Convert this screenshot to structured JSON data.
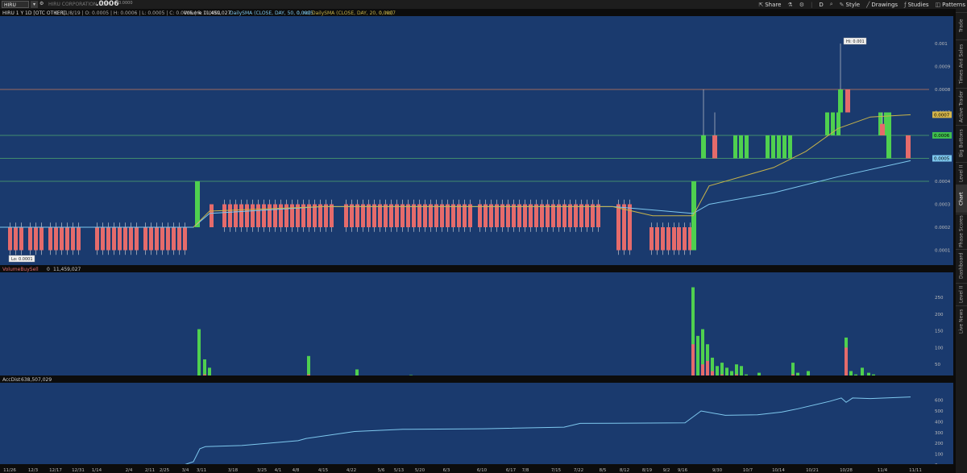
{
  "header": {
    "symbol": "HIRU",
    "company": "HIRU CORPORATION COM",
    "last": ".0006",
    "change_small": "0.0000",
    "toolbar": [
      "Share",
      "Style",
      "Drawings",
      "Studies",
      "Patterns"
    ],
    "toolbar_d": "D"
  },
  "price_panel": {
    "title": "HIRU 1 Y 1D [OTC OTHER]",
    "stats": "D: 11/8/19 | O: 0.0005 | H: 0.0006 | L: 0.0005 | C: 0.0006 | R: 0.0001",
    "volume_label": "Volume",
    "volume_value": "11,459,027",
    "sma50": "DailySMA (CLOSE, DAY, 50, 0, no)",
    "sma50_value": "0.0005",
    "sma20": "DailySMA (CLOSE, DAY, 20, 0, no)",
    "sma20_value": "0.0007",
    "hi_label": "Hi: 0.001",
    "lo_label": "Lo: 0.0001",
    "yticks": [
      "0.001",
      "0.0009",
      "0.0008",
      "0.0007",
      "0.0006",
      "0.0005",
      "0.0004",
      "0.0003",
      "0.0002",
      "0.0001"
    ],
    "tags": {
      "sma20": "0.0007",
      "close": "0.0006",
      "sma50": "0.0005"
    },
    "colors": {
      "background": "#1a3a6e",
      "up": "#4fd04f",
      "down": "#e56b6b",
      "sma20": "#c8b44a",
      "sma50": "#7ec8ee",
      "hline": "#4fa86e",
      "hline_top": "#c87a5a"
    }
  },
  "volume_panel": {
    "title": "VolumeBuySell",
    "value1": "0",
    "value2": "11,459,027",
    "yticks": [
      "250",
      "200",
      "150",
      "100",
      "50",
      "0"
    ]
  },
  "accdist_panel": {
    "title": "AccDist",
    "value": "638,507,029",
    "yticks": [
      "600",
      "500",
      "400",
      "300",
      "200",
      "100",
      "0"
    ]
  },
  "x_labels": [
    "11/26",
    "12/3",
    "12/17",
    "12/31",
    "1/14",
    "2/4",
    "2/11",
    "2/25",
    "3/4",
    "3/11",
    "3/18",
    "3/25",
    "4/1",
    "4/8",
    "4/15",
    "4/22",
    "5/6",
    "5/13",
    "5/20",
    "6/3",
    "6/10",
    "6/17",
    "7/8",
    "7/15",
    "7/22",
    "8/5",
    "8/12",
    "8/19",
    "9/2",
    "9/16",
    "9/30",
    "10/7",
    "10/14",
    "10/21",
    "10/28",
    "11/4",
    "11/11"
  ],
  "right_tabs": [
    "Trade",
    "Times And Sales",
    "Active Trader",
    "Big Buttons",
    "Level II",
    "Chart",
    "Phase Scores",
    "Dashboard",
    "Level II",
    "Live News"
  ],
  "chart_data": {
    "type": "candlestick",
    "price_unit": "USD",
    "ylim": [
      0,
      0.0011
    ],
    "candles": [
      {
        "x": "11/26",
        "o": 0.0002,
        "h": 0.0002,
        "l": 0.0001,
        "c": 0.0001
      },
      {
        "x": "12/3",
        "o": 0.0002,
        "h": 0.0002,
        "l": 0.0001,
        "c": 0.0001
      },
      {
        "x": "12/17",
        "o": 0.0002,
        "h": 0.0002,
        "l": 0.0001,
        "c": 0.0001
      },
      {
        "x": "12/31",
        "o": 0.0002,
        "h": 0.0002,
        "l": 0.0001,
        "c": 0.0001
      },
      {
        "x": "1/14",
        "o": 0.0002,
        "h": 0.0002,
        "l": 0.0001,
        "c": 0.0001
      },
      {
        "x": "2/4",
        "o": 0.0002,
        "h": 0.0002,
        "l": 0.0001,
        "c": 0.0001
      },
      {
        "x": "2/11",
        "o": 0.0002,
        "h": 0.0002,
        "l": 0.0001,
        "c": 0.0001
      },
      {
        "x": "2/25",
        "o": 0.0002,
        "h": 0.0002,
        "l": 0.0001,
        "c": 0.0001
      },
      {
        "x": "3/4",
        "o": 0.0002,
        "h": 0.0004,
        "l": 0.0002,
        "c": 0.0004
      },
      {
        "x": "3/11",
        "o": 0.0003,
        "h": 0.0003,
        "l": 0.0002,
        "c": 0.0002
      },
      {
        "x": "3/18",
        "o": 0.0003,
        "h": 0.0003,
        "l": 0.0002,
        "c": 0.0002
      },
      {
        "x": "4/8",
        "o": 0.0003,
        "h": 0.00035,
        "l": 0.0002,
        "c": 0.0002
      },
      {
        "x": "4/22",
        "o": 0.0003,
        "h": 0.0003,
        "l": 0.0002,
        "c": 0.0002
      },
      {
        "x": "5/20",
        "o": 0.0003,
        "h": 0.0003,
        "l": 0.0002,
        "c": 0.0002
      },
      {
        "x": "6/17",
        "o": 0.0003,
        "h": 0.0003,
        "l": 0.0002,
        "c": 0.0002
      },
      {
        "x": "7/22",
        "o": 0.0003,
        "h": 0.0003,
        "l": 0.0001,
        "c": 0.0001
      },
      {
        "x": "8/19",
        "o": 0.0002,
        "h": 0.0002,
        "l": 0.0001,
        "c": 0.0001
      },
      {
        "x": "9/16",
        "o": 0.0001,
        "h": 0.0004,
        "l": 0.0001,
        "c": 0.0004
      },
      {
        "x": "9/30",
        "o": 0.0006,
        "h": 0.0008,
        "l": 0.0005,
        "c": 0.0005
      },
      {
        "x": "10/14",
        "o": 0.0005,
        "h": 0.0007,
        "l": 0.0005,
        "c": 0.0007
      },
      {
        "x": "10/28",
        "o": 0.0008,
        "h": 0.001,
        "l": 0.0007,
        "c": 0.0007
      },
      {
        "x": "11/11",
        "o": 0.0005,
        "h": 0.0006,
        "l": 0.0005,
        "c": 0.0006
      }
    ],
    "horizontal_lines": [
      0.0008,
      0.0006,
      0.0005,
      0.0004
    ],
    "volume_peak": 280,
    "accdist_last": 638
  }
}
